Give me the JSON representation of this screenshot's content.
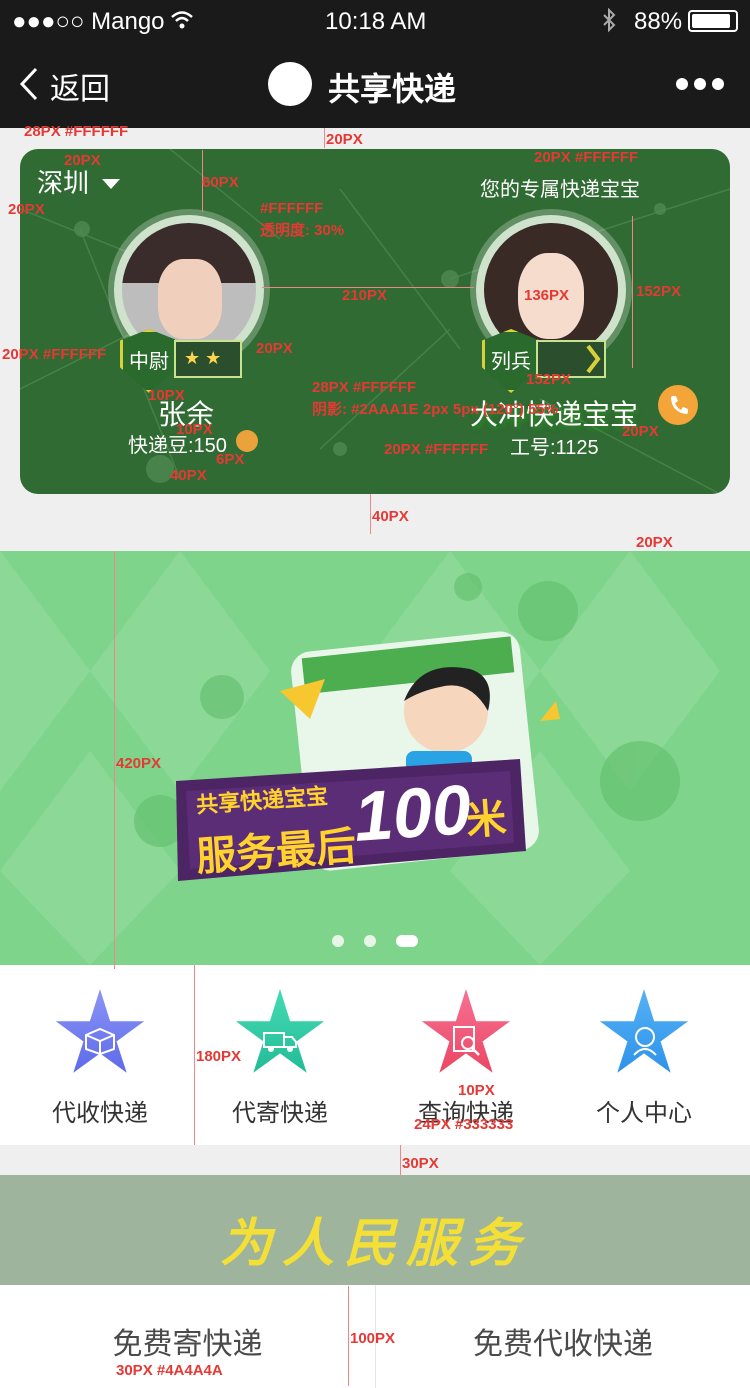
{
  "status": {
    "carrier": "●●●○○ Mango",
    "time": "10:18 AM",
    "battery": "88%"
  },
  "nav": {
    "back_label": "返回",
    "title": "共享快递"
  },
  "card": {
    "city": "深圳",
    "right_caption": "您的专属快递宝宝",
    "left_user": {
      "name": "张余",
      "rank": "中尉",
      "rank_stars": "★ ★",
      "points": "快递豆:150"
    },
    "right_user": {
      "name": "大冲快递宝宝",
      "rank": "列兵",
      "work_id": "工号:1125"
    }
  },
  "banner": {
    "line1": "共享快递宝宝",
    "line2": "服务最后",
    "big": "100",
    "unit": "米"
  },
  "menu": [
    {
      "label": "代收快递",
      "color": "#7a88f4",
      "icon": "box-icon"
    },
    {
      "label": "代寄快递",
      "color": "#2fc9a4",
      "icon": "truck-icon"
    },
    {
      "label": "查询快递",
      "color": "#f0567b",
      "icon": "search-doc-icon"
    },
    {
      "label": "个人中心",
      "color": "#3aa0f2",
      "icon": "person-icon"
    }
  ],
  "slogan": "为人民服务",
  "bottom": {
    "left": "免费寄快递",
    "right": "免费代收快递"
  },
  "annotations": {
    "a1": "28PX #FFFFFF",
    "a2": "20PX",
    "a3": "20PX",
    "a4": "20PX",
    "a5": "60PX",
    "a6": "#FFFFFF",
    "a7": "透明度: 30%",
    "a8": "20PX #FFFFFF",
    "a9": "210PX",
    "a10": "136PX",
    "a11": "152PX",
    "a12": "20PX #FFFFFF",
    "a13": "20PX",
    "a14": "152PX",
    "a15": "10PX",
    "a16": "28PX #FFFFFF",
    "a17": "阴影: #2AAA1E 2px 5px (120°) 55%",
    "a18": "10PX",
    "a19": "6PX",
    "a20": "20PX",
    "a21": "40PX",
    "a22": "20PX #FFFFFF",
    "a23": "40PX",
    "a24": "20PX",
    "a25": "420PX",
    "a26": "180PX",
    "a27": "10PX",
    "a28": "24PX #333333",
    "a29": "30PX",
    "a30": "100PX",
    "a31": "30PX #4A4A4A"
  }
}
